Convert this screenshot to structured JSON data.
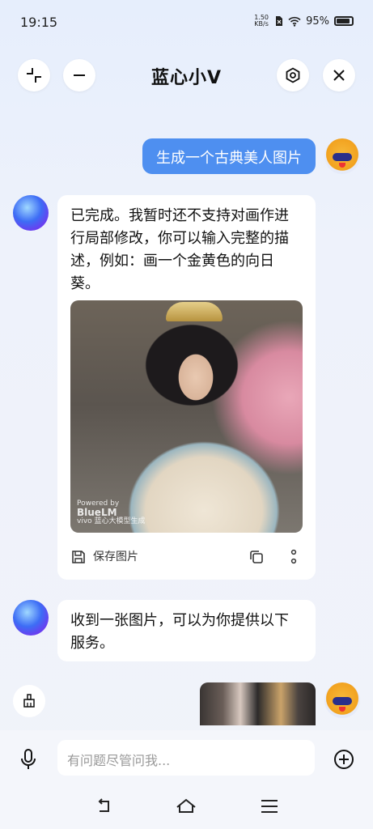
{
  "status": {
    "time": "19:15",
    "speed_value": "1.50",
    "speed_unit": "KB/s",
    "battery": "95%"
  },
  "header": {
    "title": "蓝心小V"
  },
  "messages": {
    "user_prompt": "生成一个古典美人图片",
    "ai_reply_1": "已完成。我暂时还不支持对画作进行局部修改，你可以输入完整的描述，例如：画一个金黄色的向日葵。",
    "image_watermark": {
      "powered": "Powered by",
      "brand": "BlueLM",
      "sub": "vivo 蓝心大模型生成"
    },
    "save_label": "保存图片",
    "ai_reply_2": "收到一张图片，可以为你提供以下服务。"
  },
  "input": {
    "placeholder": "有问题尽管问我..."
  },
  "colors": {
    "accent": "#4e8ff0",
    "background": "#eef2fb"
  }
}
